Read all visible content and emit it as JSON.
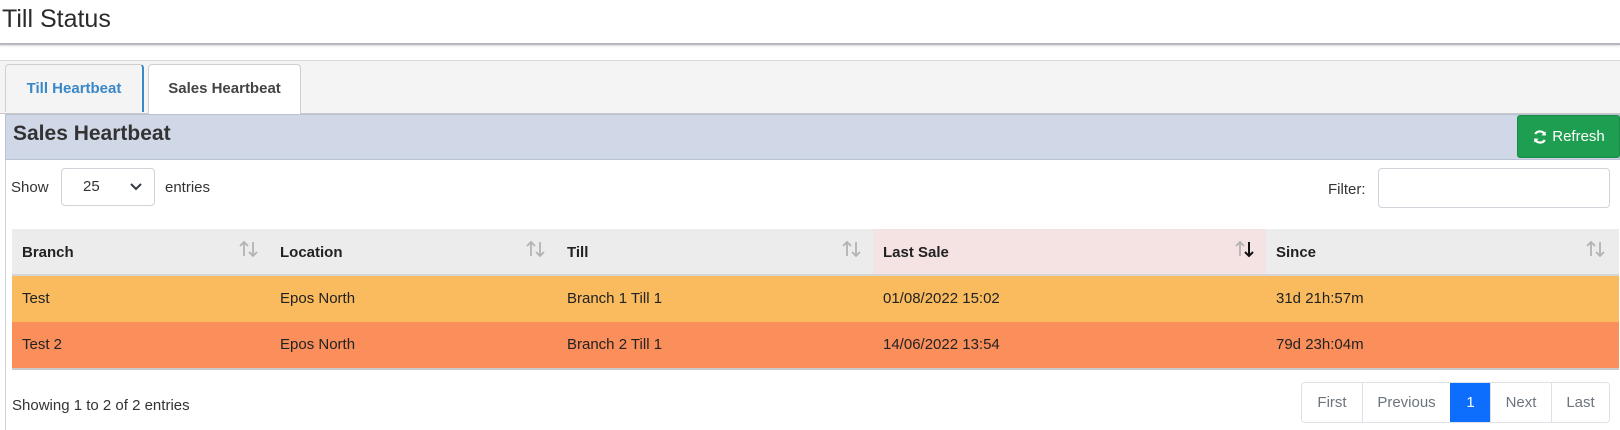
{
  "page": {
    "title": "Till Status"
  },
  "tabs": [
    {
      "label": "Till Heartbeat",
      "active": false
    },
    {
      "label": "Sales Heartbeat",
      "active": true
    }
  ],
  "panel": {
    "title": "Sales Heartbeat",
    "refresh_label": "Refresh"
  },
  "length_menu": {
    "show_label": "Show",
    "selected": "25",
    "entries_label": "entries"
  },
  "filter": {
    "label": "Filter:",
    "value": ""
  },
  "table": {
    "columns": [
      "Branch",
      "Location",
      "Till",
      "Last Sale",
      "Since"
    ],
    "sorted_column": "Last Sale",
    "sort_direction": "descending",
    "rows": [
      {
        "branch": "Test",
        "location": "Epos North",
        "till": "Branch 1 Till 1",
        "last_sale": "01/08/2022 15:02",
        "since": "31d 21h:57m",
        "color": "#f9bb5e"
      },
      {
        "branch": "Test 2",
        "location": "Epos North",
        "till": "Branch 2 Till 1",
        "last_sale": "14/06/2022 13:54",
        "since": "79d 23h:04m",
        "color": "#fa8f5b"
      }
    ]
  },
  "info": "Showing 1 to 2 of 2 entries",
  "pagination": {
    "first": "First",
    "previous": "Previous",
    "current": "1",
    "next": "Next",
    "last": "Last"
  },
  "colors": {
    "refresh_button": "#1e9e50",
    "active_page": "#0d6efd",
    "panel_header": "#d0d8e8",
    "tab_link": "#3a87c8"
  },
  "icons": {
    "refresh": "refresh-icon",
    "sort": "sort-both-icon",
    "sort_desc": "sort-desc-icon",
    "select": "chevron-down-icon"
  }
}
